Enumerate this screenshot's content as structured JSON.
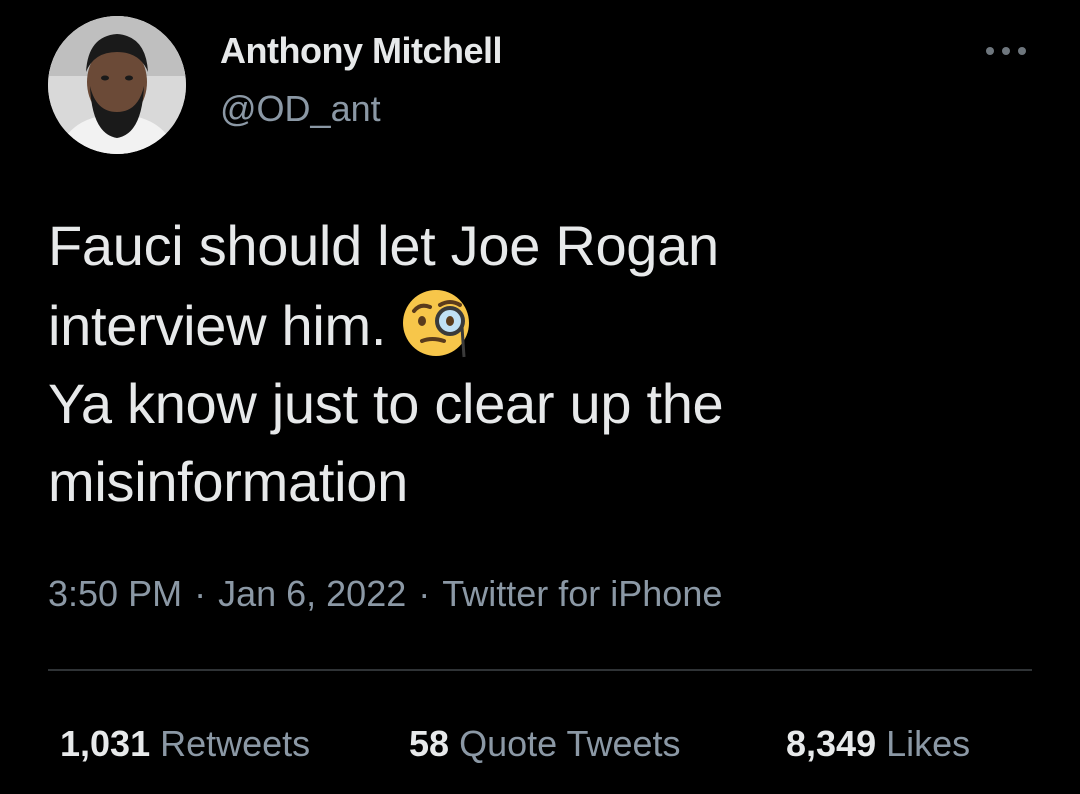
{
  "author": {
    "display_name": "Anthony Mitchell",
    "handle": "@OD_ant",
    "avatar_icon": "profile-photo"
  },
  "tweet": {
    "lines": [
      "Fauci should let Joe Rogan",
      "interview him.",
      "Ya know just to clear up the",
      "misinformation"
    ],
    "emoji": "face-with-monocle-emoji"
  },
  "meta": {
    "time": "3:50 PM",
    "separator": "·",
    "date": "Jan 6, 2022",
    "source": "Twitter for iPhone"
  },
  "stats": {
    "retweets": {
      "count": "1,031",
      "label": "Retweets"
    },
    "quotes": {
      "count": "58",
      "label": "Quote Tweets"
    },
    "likes": {
      "count": "8,349",
      "label": "Likes"
    }
  },
  "colors": {
    "background": "#000000",
    "primary_text": "#e7e9ea",
    "secondary_text": "#8b98a5",
    "divider": "#2f3336"
  }
}
